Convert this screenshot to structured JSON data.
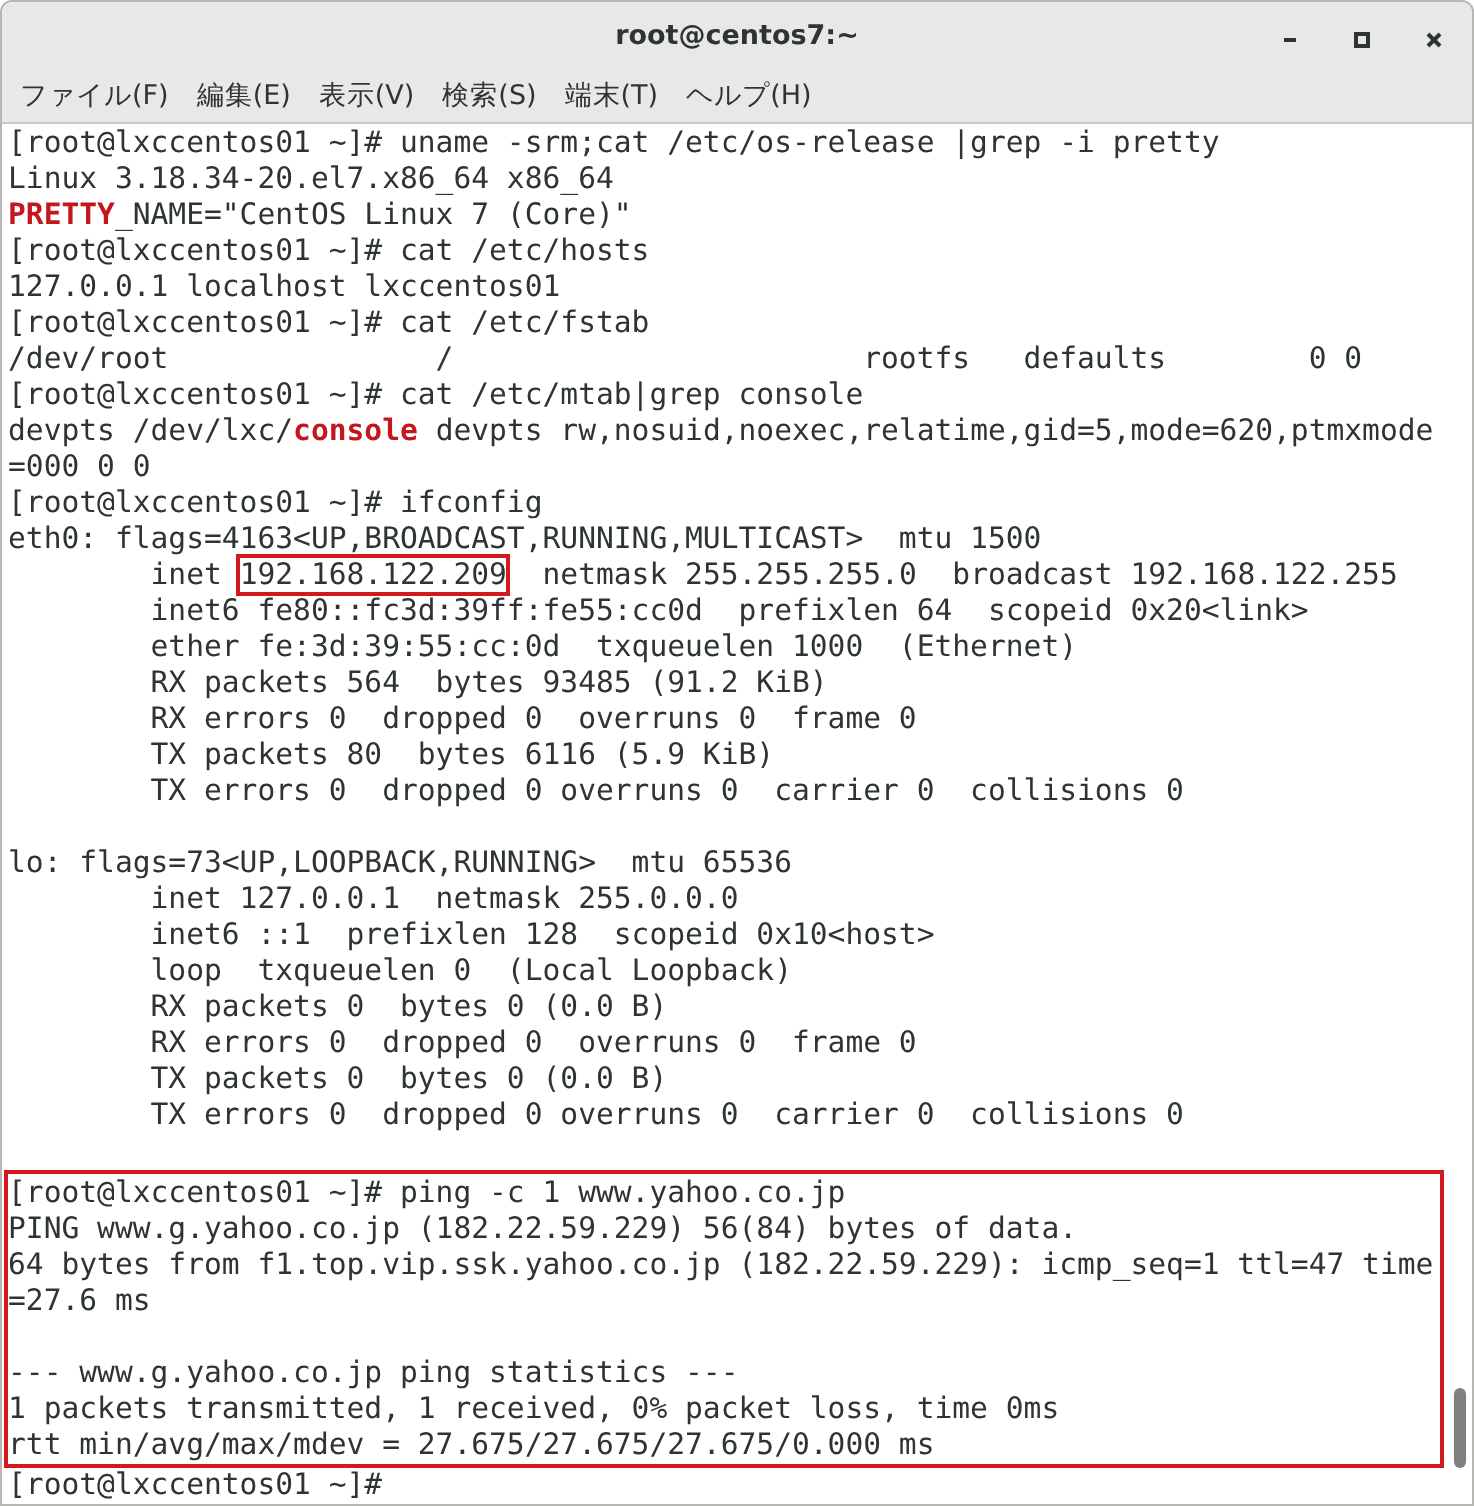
{
  "window": {
    "title": "root@centos7:~"
  },
  "menu": [
    "ファイル(F)",
    "編集(E)",
    "表示(V)",
    "検索(S)",
    "端末(T)",
    "ヘルプ(H)"
  ],
  "terminal": {
    "blocks": [
      {
        "boxed": false,
        "lines": [
          {
            "kind": "text",
            "segments": [
              {
                "kind": "plain",
                "text": "[root@lxccentos01 ~]# uname -srm;cat /etc/os-release |grep -i pretty"
              }
            ]
          },
          {
            "kind": "text",
            "segments": [
              {
                "kind": "plain",
                "text": "Linux 3.18.34-20.el7.x86_64 x86_64"
              }
            ]
          },
          {
            "kind": "text",
            "segments": [
              {
                "kind": "match",
                "text": "PRETTY"
              },
              {
                "kind": "plain",
                "text": "_NAME=\"CentOS Linux 7 (Core)\""
              }
            ]
          },
          {
            "kind": "text",
            "segments": [
              {
                "kind": "plain",
                "text": "[root@lxccentos01 ~]# cat /etc/hosts"
              }
            ]
          },
          {
            "kind": "text",
            "segments": [
              {
                "kind": "plain",
                "text": "127.0.0.1 localhost lxccentos01"
              }
            ]
          },
          {
            "kind": "text",
            "segments": [
              {
                "kind": "plain",
                "text": "[root@lxccentos01 ~]# cat /etc/fstab"
              }
            ]
          },
          {
            "kind": "text",
            "segments": [
              {
                "kind": "plain",
                "text": "/dev/root               /                       rootfs   defaults        0 0"
              }
            ]
          },
          {
            "kind": "text",
            "segments": [
              {
                "kind": "plain",
                "text": "[root@lxccentos01 ~]# cat /etc/mtab|grep console"
              }
            ]
          },
          {
            "kind": "text",
            "segments": [
              {
                "kind": "plain",
                "text": "devpts /dev/lxc/"
              },
              {
                "kind": "match",
                "text": "console"
              },
              {
                "kind": "plain",
                "text": " devpts rw,nosuid,noexec,relatime,gid=5,mode=620,ptmxmode"
              }
            ]
          },
          {
            "kind": "text",
            "segments": [
              {
                "kind": "plain",
                "text": "=000 0 0"
              }
            ]
          },
          {
            "kind": "text",
            "segments": [
              {
                "kind": "plain",
                "text": "[root@lxccentos01 ~]# ifconfig"
              }
            ]
          },
          {
            "kind": "text",
            "segments": [
              {
                "kind": "plain",
                "text": "eth0: flags=4163<UP,BROADCAST,RUNNING,MULTICAST>  mtu 1500"
              }
            ]
          },
          {
            "kind": "text",
            "segments": [
              {
                "kind": "plain",
                "text": "        inet "
              },
              {
                "kind": "boxed",
                "text": "192.168.122.209"
              },
              {
                "kind": "plain",
                "text": "  netmask 255.255.255.0  broadcast 192.168.122.255"
              }
            ]
          },
          {
            "kind": "text",
            "segments": [
              {
                "kind": "plain",
                "text": "        inet6 fe80::fc3d:39ff:fe55:cc0d  prefixlen 64  scopeid 0x20<link>"
              }
            ]
          },
          {
            "kind": "text",
            "segments": [
              {
                "kind": "plain",
                "text": "        ether fe:3d:39:55:cc:0d  txqueuelen 1000  (Ethernet)"
              }
            ]
          },
          {
            "kind": "text",
            "segments": [
              {
                "kind": "plain",
                "text": "        RX packets 564  bytes 93485 (91.2 KiB)"
              }
            ]
          },
          {
            "kind": "text",
            "segments": [
              {
                "kind": "plain",
                "text": "        RX errors 0  dropped 0  overruns 0  frame 0"
              }
            ]
          },
          {
            "kind": "text",
            "segments": [
              {
                "kind": "plain",
                "text": "        TX packets 80  bytes 6116 (5.9 KiB)"
              }
            ]
          },
          {
            "kind": "text",
            "segments": [
              {
                "kind": "plain",
                "text": "        TX errors 0  dropped 0 overruns 0  carrier 0  collisions 0"
              }
            ]
          },
          {
            "kind": "blank"
          },
          {
            "kind": "text",
            "segments": [
              {
                "kind": "plain",
                "text": "lo: flags=73<UP,LOOPBACK,RUNNING>  mtu 65536"
              }
            ]
          },
          {
            "kind": "text",
            "segments": [
              {
                "kind": "plain",
                "text": "        inet 127.0.0.1  netmask 255.0.0.0"
              }
            ]
          },
          {
            "kind": "text",
            "segments": [
              {
                "kind": "plain",
                "text": "        inet6 ::1  prefixlen 128  scopeid 0x10<host>"
              }
            ]
          },
          {
            "kind": "text",
            "segments": [
              {
                "kind": "plain",
                "text": "        loop  txqueuelen 0  (Local Loopback)"
              }
            ]
          },
          {
            "kind": "text",
            "segments": [
              {
                "kind": "plain",
                "text": "        RX packets 0  bytes 0 (0.0 B)"
              }
            ]
          },
          {
            "kind": "text",
            "segments": [
              {
                "kind": "plain",
                "text": "        RX errors 0  dropped 0  overruns 0  frame 0"
              }
            ]
          },
          {
            "kind": "text",
            "segments": [
              {
                "kind": "plain",
                "text": "        TX packets 0  bytes 0 (0.0 B)"
              }
            ]
          },
          {
            "kind": "text",
            "segments": [
              {
                "kind": "plain",
                "text": "        TX errors 0  dropped 0 overruns 0  carrier 0  collisions 0"
              }
            ]
          },
          {
            "kind": "blank"
          }
        ]
      },
      {
        "boxed": true,
        "lines": [
          {
            "kind": "text",
            "segments": [
              {
                "kind": "plain",
                "text": "[root@lxccentos01 ~]# ping -c 1 www.yahoo.co.jp"
              }
            ]
          },
          {
            "kind": "text",
            "segments": [
              {
                "kind": "plain",
                "text": "PING www.g.yahoo.co.jp (182.22.59.229) 56(84) bytes of data."
              }
            ]
          },
          {
            "kind": "text",
            "segments": [
              {
                "kind": "plain",
                "text": "64 bytes from f1.top.vip.ssk.yahoo.co.jp (182.22.59.229): icmp_seq=1 ttl=47 time"
              }
            ]
          },
          {
            "kind": "text",
            "segments": [
              {
                "kind": "plain",
                "text": "=27.6 ms"
              }
            ]
          },
          {
            "kind": "blank"
          },
          {
            "kind": "text",
            "segments": [
              {
                "kind": "plain",
                "text": "--- www.g.yahoo.co.jp ping statistics ---"
              }
            ]
          },
          {
            "kind": "text",
            "segments": [
              {
                "kind": "plain",
                "text": "1 packets transmitted, 1 received, 0% packet loss, time 0ms"
              }
            ]
          },
          {
            "kind": "text",
            "segments": [
              {
                "kind": "plain",
                "text": "rtt min/avg/max/mdev = 27.675/27.675/27.675/0.000 ms"
              }
            ]
          }
        ]
      },
      {
        "boxed": false,
        "lines": [
          {
            "kind": "text",
            "segments": [
              {
                "kind": "plain",
                "text": "[root@lxccentos01 ~]#"
              }
            ]
          }
        ]
      }
    ]
  }
}
